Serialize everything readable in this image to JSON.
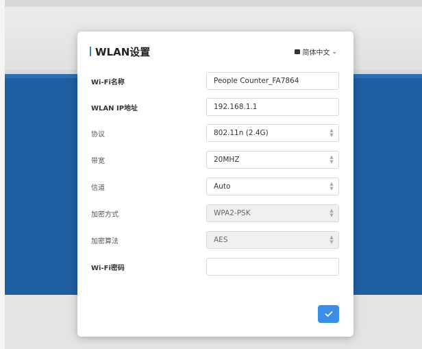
{
  "dialog": {
    "title": "WLAN设置",
    "language": "简体中文",
    "fields": [
      {
        "label": "Wi-Fi名称",
        "value": "People Counter_FA7864"
      },
      {
        "label": "WLAN IP地址",
        "value": "192.168.1.1"
      },
      {
        "label": "协议",
        "value": "802.11n (2.4G)"
      },
      {
        "label": "带宽",
        "value": "20MHZ"
      },
      {
        "label": "信道",
        "value": "Auto"
      },
      {
        "label": "加密方式",
        "value": "WPA2-PSK"
      },
      {
        "label": "加密算法",
        "value": "AES"
      },
      {
        "label": "Wi-Fi密码",
        "value": ""
      }
    ]
  },
  "colors": {
    "accent": "#3a8ee6",
    "band": "#1f5ea1"
  },
  "icons": {
    "language": "globe-icon",
    "confirm": "check-icon"
  }
}
